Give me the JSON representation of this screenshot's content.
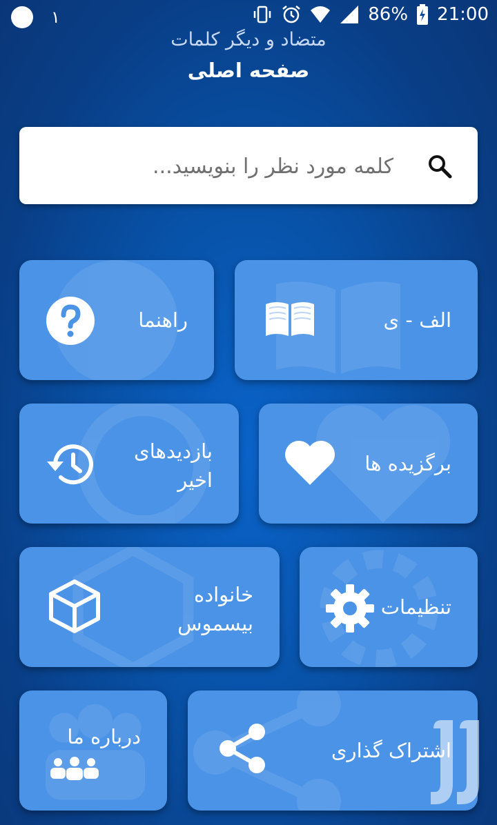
{
  "status_bar": {
    "notification_count": "١",
    "battery": "86%",
    "time": "21:00"
  },
  "header": {
    "app_title": "متضاد و دیگر کلمات",
    "page_title": "صفحه اصلی"
  },
  "search": {
    "placeholder": "کلمه مورد نظر را بنویسید..."
  },
  "tiles": {
    "guide": {
      "label": "راهنما",
      "icon": "question-icon"
    },
    "alphabet": {
      "label": "الف - ی",
      "icon": "book-icon"
    },
    "recent": {
      "label_line1": "بازدیدهای",
      "label_line2": "اخیر",
      "icon": "history-icon"
    },
    "favorites": {
      "label": "برگزیده ها",
      "icon": "heart-icon"
    },
    "family": {
      "label_line1": "خانواده",
      "label_line2": "بیسموس",
      "icon": "cube-icon"
    },
    "settings": {
      "label": "تنظیمات",
      "icon": "gear-icon"
    },
    "about": {
      "label": "درباره ما",
      "icon": "people-icon"
    },
    "share": {
      "label": "اشتراک گذاری",
      "icon": "share-icon"
    }
  },
  "colors": {
    "background": "#0852a8",
    "tile": "#4b93e6",
    "search_bg": "#ffffff"
  }
}
